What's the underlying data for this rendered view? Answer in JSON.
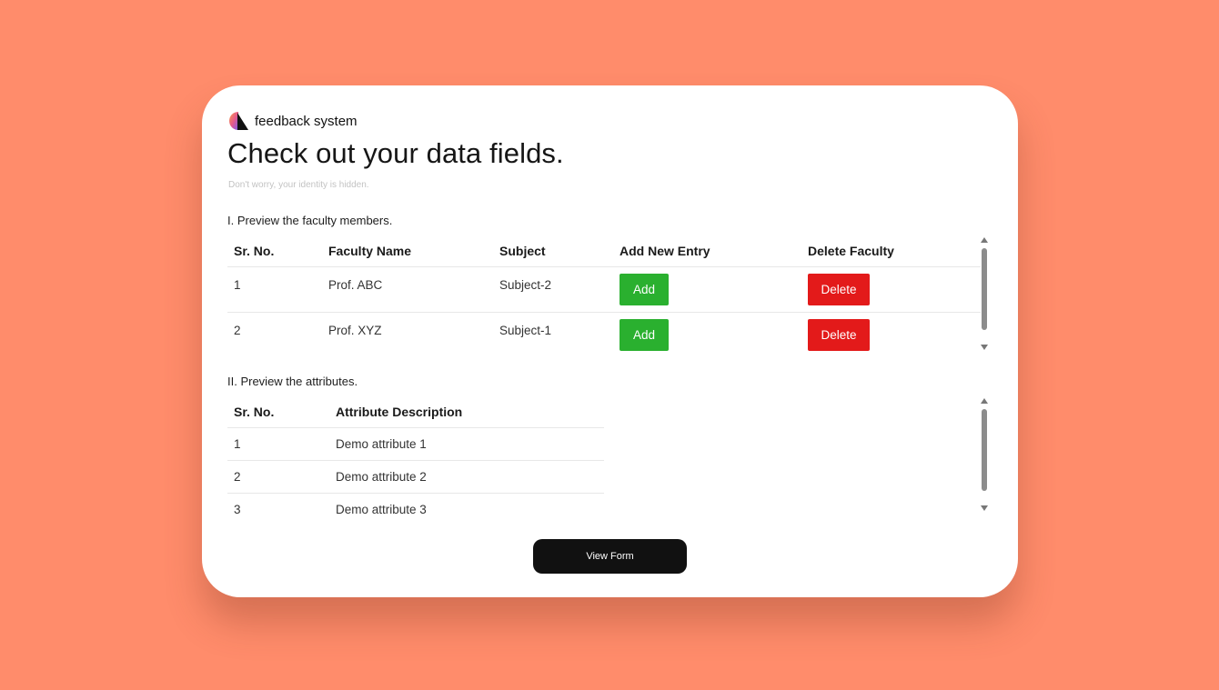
{
  "brand": {
    "name": "feedback system",
    "logo_icon": "half-circle-logo-icon"
  },
  "header": {
    "title": "Check out your data fields.",
    "subtitle": "Don't worry, your identity is hidden."
  },
  "faculty_section": {
    "title": "I. Preview the faculty members.",
    "columns": [
      "Sr. No.",
      "Faculty Name",
      "Subject",
      "Add New Entry",
      "Delete Faculty"
    ],
    "rows": [
      {
        "sr": "1",
        "name": "Prof. ABC",
        "subject": "Subject-2",
        "add_label": "Add",
        "delete_label": "Delete"
      },
      {
        "sr": "2",
        "name": "Prof. XYZ",
        "subject": "Subject-1",
        "add_label": "Add",
        "delete_label": "Delete"
      }
    ]
  },
  "attributes_section": {
    "title": "II. Preview the attributes.",
    "columns": [
      "Sr. No.",
      "Attribute Description"
    ],
    "rows": [
      {
        "sr": "1",
        "description": "Demo attribute 1"
      },
      {
        "sr": "2",
        "description": "Demo attribute 2"
      },
      {
        "sr": "3",
        "description": "Demo attribute 3"
      }
    ]
  },
  "footer": {
    "view_form_label": "View Form"
  },
  "colors": {
    "background": "#ff8c6b",
    "card": "#ffffff",
    "add_button": "#2ab02f",
    "delete_button": "#e31a1a",
    "primary_button": "#111111"
  }
}
